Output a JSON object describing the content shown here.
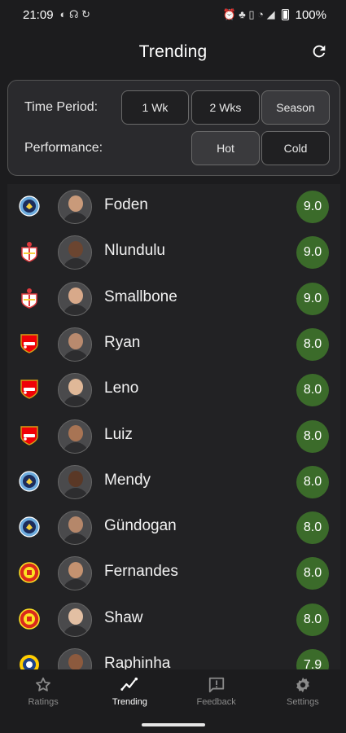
{
  "status_bar": {
    "time": "21:09",
    "battery": "100%"
  },
  "app_bar": {
    "title": "Trending",
    "refresh_icon": "refresh-icon"
  },
  "filters": {
    "time_period_label": "Time Period:",
    "time_period_options": [
      "1 Wk",
      "2 Wks",
      "Season"
    ],
    "time_period_selected": "Season",
    "performance_label": "Performance:",
    "performance_options": [
      "Hot",
      "Cold"
    ],
    "performance_selected": "Hot"
  },
  "colors": {
    "score_green": "#3b6b2a",
    "background": "#1c1c1e",
    "card": "#2a2a2d"
  },
  "players": [
    {
      "name": "Foden",
      "club": "man-city",
      "score": "9.0"
    },
    {
      "name": "Nlundulu",
      "club": "southampton",
      "score": "9.0"
    },
    {
      "name": "Smallbone",
      "club": "southampton",
      "score": "9.0"
    },
    {
      "name": "Ryan",
      "club": "arsenal",
      "score": "8.0"
    },
    {
      "name": "Leno",
      "club": "arsenal",
      "score": "8.0"
    },
    {
      "name": "Luiz",
      "club": "arsenal",
      "score": "8.0"
    },
    {
      "name": "Mendy",
      "club": "man-city",
      "score": "8.0"
    },
    {
      "name": "Gündogan",
      "club": "man-city",
      "score": "8.0"
    },
    {
      "name": "Fernandes",
      "club": "man-united",
      "score": "8.0"
    },
    {
      "name": "Shaw",
      "club": "man-united",
      "score": "8.0"
    },
    {
      "name": "Raphinha",
      "club": "leeds",
      "score": "7.9"
    }
  ],
  "bottom_nav": {
    "items": [
      {
        "label": "Ratings",
        "icon": "star-icon"
      },
      {
        "label": "Trending",
        "icon": "trending-icon"
      },
      {
        "label": "Feedback",
        "icon": "feedback-icon"
      },
      {
        "label": "Settings",
        "icon": "gear-icon"
      }
    ],
    "active": "Trending"
  }
}
